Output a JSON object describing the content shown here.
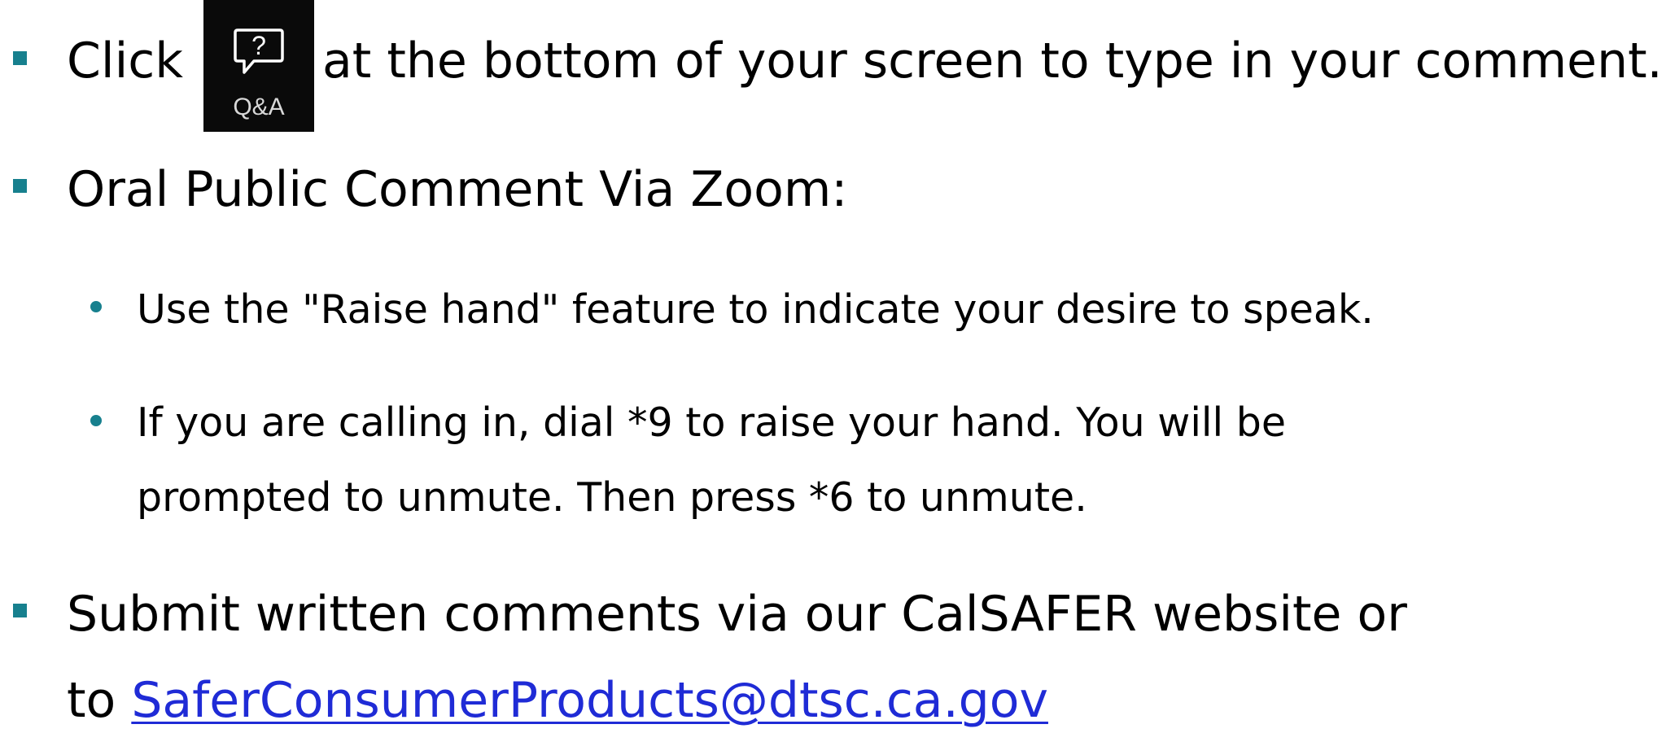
{
  "bullet_color": "#17808e",
  "link_color": "#1f2bd6",
  "items": [
    {
      "prefix": "Click",
      "icon": "qa-icon",
      "icon_label": "Q&A",
      "suffix": "at the bottom of your screen to type in your comment."
    },
    {
      "text": "Oral Public Comment Via Zoom:",
      "subitems": [
        {
          "text": "Use the \"Raise hand\" feature to indicate your desire to speak."
        },
        {
          "line1": "If you are calling in, dial *9 to raise your hand. You will be",
          "line2": "prompted to unmute. Then press *6 to unmute."
        }
      ]
    },
    {
      "line1": "Submit written comments via our CalSAFER website or",
      "line2_prefix": "to",
      "email": "SaferConsumerProducts@dtsc.ca.gov"
    }
  ]
}
